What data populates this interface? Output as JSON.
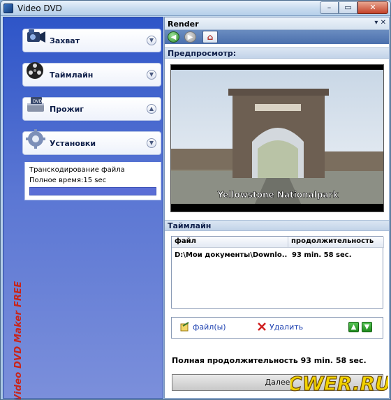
{
  "window": {
    "title": "Video DVD",
    "min_glyph": "–",
    "max_glyph": "▭",
    "close_glyph": "✕"
  },
  "sidebar": {
    "brand": "Video DVD Maker FREE",
    "items": [
      {
        "label": "Захват",
        "icon": "camcorder-icon",
        "chevron": "down"
      },
      {
        "label": "Таймлайн",
        "icon": "film-reel-icon",
        "chevron": "down"
      },
      {
        "label": "Прожиг",
        "icon": "dvd-burn-icon",
        "chevron": "up"
      },
      {
        "label": "Установки",
        "icon": "settings-gear-icon",
        "chevron": "down"
      }
    ],
    "status": {
      "line1": "Транскодирование файла",
      "line2": "Полное время:15 sec"
    }
  },
  "render": {
    "title": "Render",
    "controls": "▾  ✕",
    "preview_label": "Предпросмотр:",
    "preview_caption": "Yellowstone  Nationalpark",
    "timeline_label": "Таймлайн",
    "columns": [
      "файл",
      "продолжительность"
    ],
    "rows": [
      {
        "file": "D:\\Мои документы\\Downlo...",
        "duration": "93 min. 58 sec."
      }
    ],
    "actions": {
      "add": "файл(ы)",
      "delete": "Удалить"
    },
    "total": "Полная продолжительность 93 min. 58 sec.",
    "next": "Далее"
  },
  "watermark": "CWER.RU",
  "colors": {
    "sidebar_top": "#2e55c8",
    "brand_red": "#c8251a",
    "progress": "#5b6ed6",
    "link": "#1b3fb0"
  }
}
